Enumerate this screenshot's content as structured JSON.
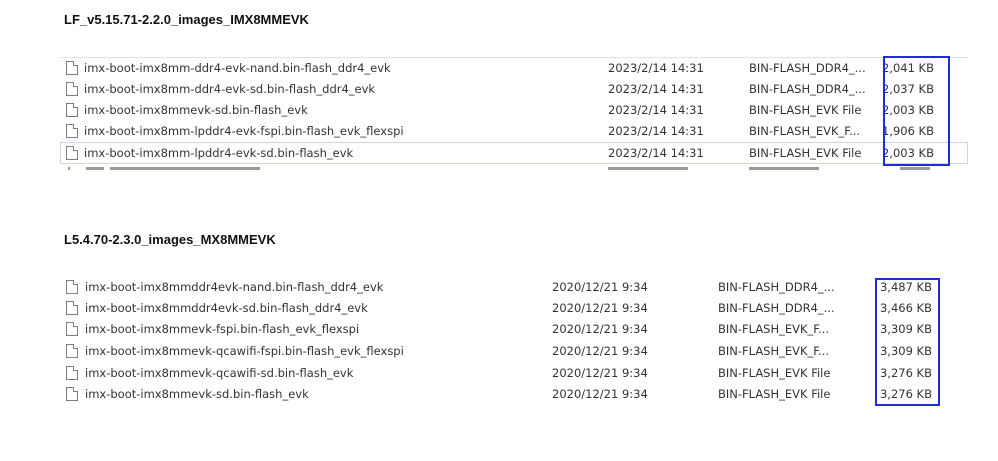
{
  "sections": [
    {
      "title": "LF_v5.15.71-2.2.0_images_IMX8MMEVK",
      "files": [
        {
          "name": "imx-boot-imx8mm-ddr4-evk-nand.bin-flash_ddr4_evk",
          "date": "2023/2/14 14:31",
          "type": "BIN-FLASH_DDR4_...",
          "size": "2,041 KB"
        },
        {
          "name": "imx-boot-imx8mm-ddr4-evk-sd.bin-flash_ddr4_evk",
          "date": "2023/2/14 14:31",
          "type": "BIN-FLASH_DDR4_...",
          "size": "2,037 KB"
        },
        {
          "name": "imx-boot-imx8mmevk-sd.bin-flash_evk",
          "date": "2023/2/14 14:31",
          "type": "BIN-FLASH_EVK File",
          "size": "2,003 KB"
        },
        {
          "name": "imx-boot-imx8mm-lpddr4-evk-fspi.bin-flash_evk_flexspi",
          "date": "2023/2/14 14:31",
          "type": "BIN-FLASH_EVK_F...",
          "size": "1,906 KB"
        },
        {
          "name": "imx-boot-imx8mm-lpddr4-evk-sd.bin-flash_evk",
          "date": "2023/2/14 14:31",
          "type": "BIN-FLASH_EVK File",
          "size": "2,003 KB"
        }
      ]
    },
    {
      "title": "L5.4.70-2.3.0_images_MX8MMEVK",
      "files": [
        {
          "name": "imx-boot-imx8mmddr4evk-nand.bin-flash_ddr4_evk",
          "date": "2020/12/21 9:34",
          "type": "BIN-FLASH_DDR4_...",
          "size": "3,487 KB"
        },
        {
          "name": "imx-boot-imx8mmddr4evk-sd.bin-flash_ddr4_evk",
          "date": "2020/12/21 9:34",
          "type": "BIN-FLASH_DDR4_...",
          "size": "3,466 KB"
        },
        {
          "name": "imx-boot-imx8mmevk-fspi.bin-flash_evk_flexspi",
          "date": "2020/12/21 9:34",
          "type": "BIN-FLASH_EVK_F...",
          "size": "3,309 KB"
        },
        {
          "name": "imx-boot-imx8mmevk-qcawifi-fspi.bin-flash_evk_flexspi",
          "date": "2020/12/21 9:34",
          "type": "BIN-FLASH_EVK_F...",
          "size": "3,309 KB"
        },
        {
          "name": "imx-boot-imx8mmevk-qcawifi-sd.bin-flash_evk",
          "date": "2020/12/21 9:34",
          "type": "BIN-FLASH_EVK File",
          "size": "3,276 KB"
        },
        {
          "name": "imx-boot-imx8mmevk-sd.bin-flash_evk",
          "date": "2020/12/21 9:34",
          "type": "BIN-FLASH_EVK File",
          "size": "3,276 KB"
        }
      ]
    }
  ],
  "colors": {
    "highlight_box": "#1f2fcf",
    "selection_border": "#c6d8ea"
  },
  "icons": {
    "file": "file-icon"
  }
}
